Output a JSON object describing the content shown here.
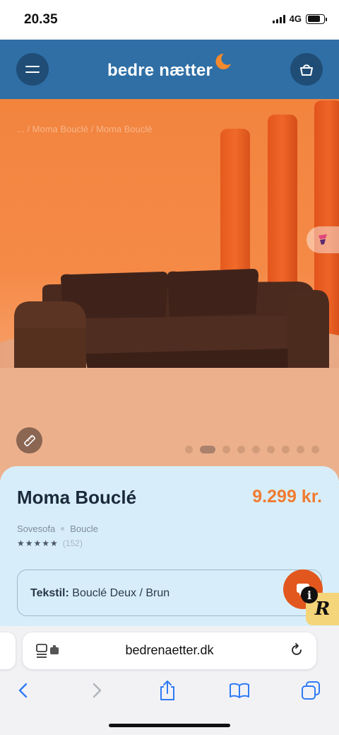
{
  "status_bar": {
    "time": "20.35",
    "network": "4G"
  },
  "header": {
    "logo_text": "bedre nætter"
  },
  "hero": {
    "breadcrumb": "... / Moma Bouclé / Moma Bouclé",
    "gallery_total": 9,
    "gallery_active_index": 1
  },
  "product": {
    "name": "Moma Bouclé",
    "price": "9.299 kr.",
    "category": "Sovesofa",
    "material": "Boucle",
    "rating_stars": "★★★★★",
    "rating_count": "(152)",
    "variant_label": "Tekstil:",
    "variant_value": "Bouclé Deux / Brun"
  },
  "badges": {
    "info": "i",
    "r_logo": "R"
  },
  "browser": {
    "url": "bedrenaetter.dk"
  },
  "colors": {
    "header_bg": "#2f6fa5",
    "accent_orange": "#f07c33",
    "panel_bg": "#d7eefa",
    "sofa_brown": "#4a2a1f"
  },
  "icons": [
    "hamburger-menu-icon",
    "shopping-bag-icon",
    "moon-icon",
    "ruler-icon",
    "chat-icon",
    "reader-mode-icon",
    "reload-icon",
    "back-icon",
    "forward-icon",
    "share-icon",
    "bookmarks-icon",
    "tabs-icon"
  ]
}
